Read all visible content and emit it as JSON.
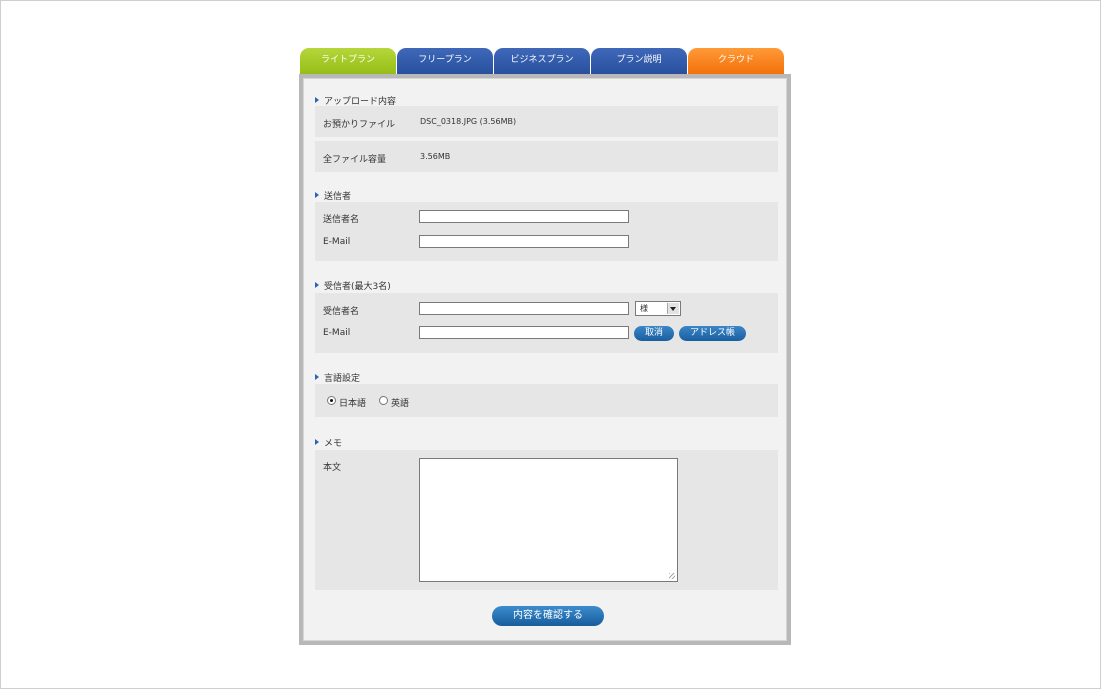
{
  "tabs": [
    {
      "label": "ライトプラン"
    },
    {
      "label": "フリープラン"
    },
    {
      "label": "ビジネスプラン"
    },
    {
      "label": "プラン説明"
    },
    {
      "label": "クラウド"
    }
  ],
  "upload": {
    "title": "アップロード内容",
    "file_label": "お預かりファイル",
    "file_value": "DSC_0318.JPG (3.56MB)",
    "total_label": "全ファイル容量",
    "total_value": "3.56MB"
  },
  "sender": {
    "title": "送信者",
    "name_label": "送信者名",
    "email_label": "E-Mail",
    "name_value": "",
    "email_value": ""
  },
  "recipient": {
    "title": "受信者(最大3名)",
    "name_label": "受信者名",
    "email_label": "E-Mail",
    "honorific_selected": "様",
    "cancel_label": "取消",
    "address_book_label": "アドレス帳"
  },
  "language": {
    "title": "言語設定",
    "options": [
      "日本語",
      "英語"
    ],
    "selected": "日本語"
  },
  "memo": {
    "title": "メモ",
    "body_label": "本文"
  },
  "submit_label": "内容を確認する",
  "colors": {
    "tab_green": "#9cc31f",
    "tab_blue": "#2f58a8",
    "tab_orange": "#f77d12",
    "button_blue": "#1f6aa8"
  }
}
